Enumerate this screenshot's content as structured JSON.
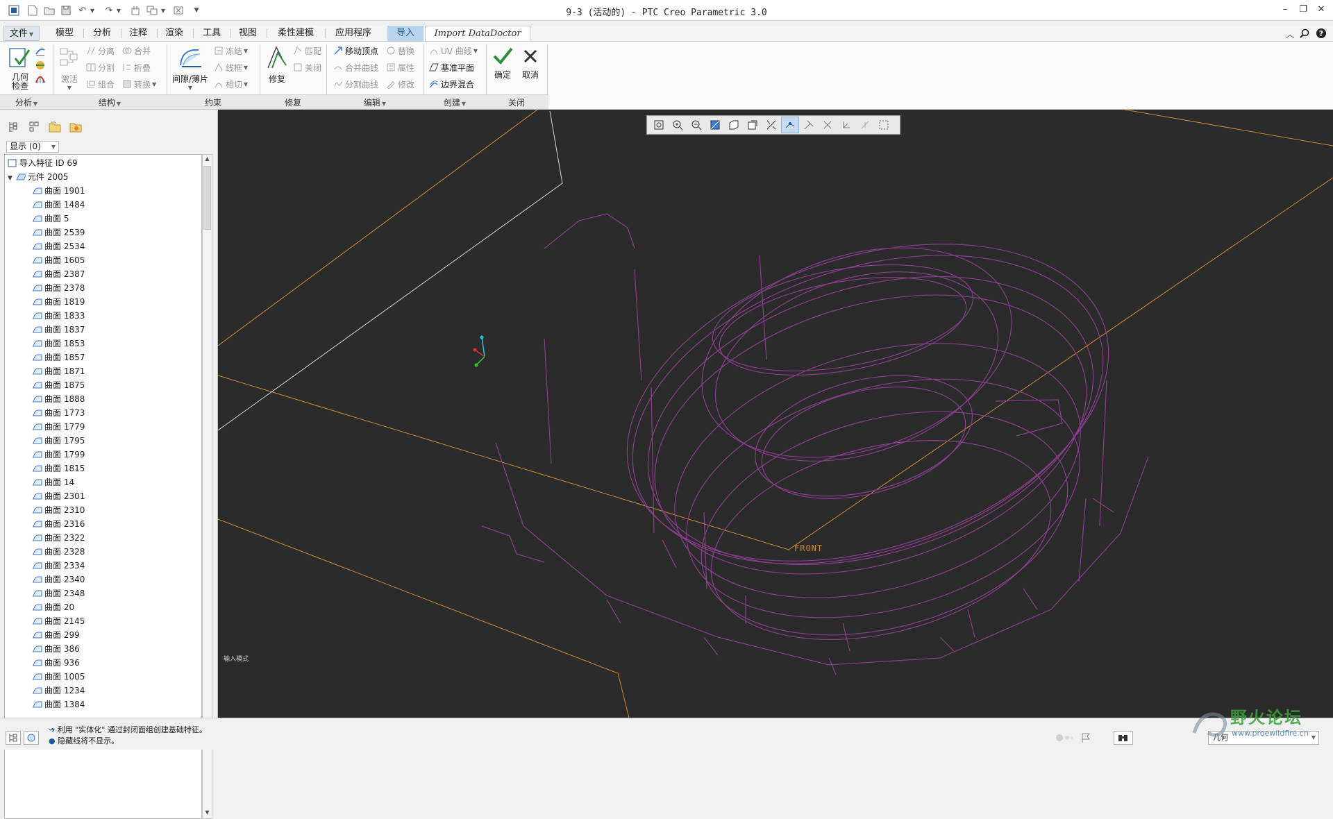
{
  "window": {
    "title": "9-3 (活动的) - PTC Creo Parametric 3.0",
    "controls": [
      "minimize-icon",
      "restore-icon",
      "close-icon"
    ]
  },
  "tabs": {
    "file": "文件",
    "items": [
      "模型",
      "分析",
      "注释",
      "渲染",
      "工具",
      "视图",
      "柔性建模",
      "应用程序"
    ],
    "import": "导入",
    "datadoctor": "Import DataDoctor"
  },
  "ribbon": {
    "analysis": {
      "check": "几何\n检查"
    },
    "structure": {
      "activate": "激活",
      "separate": "分离",
      "merge": "合并",
      "split": "分割",
      "fold": "折叠",
      "combine": "组合",
      "convert": "转换"
    },
    "constraint": {
      "gap_patch": "间隙/薄片",
      "freeze": "冻结",
      "wireframe": "线框",
      "tangent": "相切"
    },
    "repair": {
      "repair": "修复",
      "match": "匹配",
      "close": "关闭"
    },
    "edit": {
      "move_vertex": "移动顶点",
      "replace": "替换",
      "merge_curve": "合并曲线",
      "property": "属性",
      "split_curve": "分割曲线",
      "modify": "修改"
    },
    "create": {
      "uv_curve": "UV 曲线",
      "datum_plane": "基准平面",
      "boundary_blend": "边界混合"
    },
    "close": {
      "ok": "确定",
      "cancel": "取消"
    },
    "groups": [
      "分析",
      "结构",
      "约束",
      "修复",
      "编辑",
      "创建",
      "关闭"
    ]
  },
  "left_panel": {
    "show": "显示 (0)",
    "tree": {
      "root": "导入特征 ID 69",
      "part": "元件 2005",
      "surfaces": [
        "曲面 1901",
        "曲面 1484",
        "曲面 5",
        "曲面 2539",
        "曲面 2534",
        "曲面 1605",
        "曲面 2387",
        "曲面 2378",
        "曲面 1819",
        "曲面 1833",
        "曲面 1837",
        "曲面 1853",
        "曲面 1857",
        "曲面 1871",
        "曲面 1875",
        "曲面 1888",
        "曲面 1773",
        "曲面 1779",
        "曲面 1795",
        "曲面 1799",
        "曲面 1815",
        "曲面 14",
        "曲面 2301",
        "曲面 2310",
        "曲面 2316",
        "曲面 2322",
        "曲面 2328",
        "曲面 2334",
        "曲面 2340",
        "曲面 2348",
        "曲面 20",
        "曲面 2145",
        "曲面 299",
        "曲面 386",
        "曲面 936",
        "曲面 1005",
        "曲面 1234",
        "曲面 1384"
      ]
    }
  },
  "viewport": {
    "plane_label": "FRONT",
    "mode_label": "输入模式",
    "wire_color": "#8a3d8e",
    "datum_color": "#d1892e",
    "bg_color": "#2b2b2b"
  },
  "status": {
    "line1": "利用 \"实体化\" 通过封闭面组创建基础特征。",
    "line2": "隐藏线将不显示。",
    "filter_label": "几何"
  },
  "watermark": {
    "name": "野火论坛",
    "url": "www.proewildfire.cn"
  }
}
